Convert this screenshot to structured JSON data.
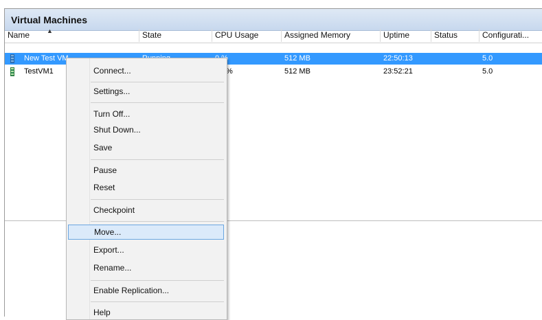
{
  "panel": {
    "title": "Virtual Machines"
  },
  "columns": {
    "name": "Name",
    "state": "State",
    "cpu": "CPU Usage",
    "memory": "Assigned Memory",
    "uptime": "Uptime",
    "status": "Status",
    "config": "Configurati..."
  },
  "vms": [
    {
      "name": "New Test VM",
      "state": "Running",
      "cpu": "0 %",
      "memory": "512 MB",
      "uptime": "22:50:13",
      "status": "",
      "config": "5.0",
      "selected": true
    },
    {
      "name": "TestVM1",
      "state": "",
      "cpu": "%",
      "memory": "512 MB",
      "uptime": "23:52:21",
      "status": "",
      "config": "5.0",
      "selected": false
    }
  ],
  "context_menu": {
    "connect": "Connect...",
    "settings": "Settings...",
    "turn_off": "Turn Off...",
    "shut_down": "Shut Down...",
    "save": "Save",
    "pause": "Pause",
    "reset": "Reset",
    "checkpoint": "Checkpoint",
    "move": "Move...",
    "export": "Export...",
    "rename": "Rename...",
    "enable_replication": "Enable Replication...",
    "help": "Help",
    "highlighted_item": "move"
  },
  "colors": {
    "selection": "#3399ff",
    "menu_highlight": "#dbeafa",
    "menu_highlight_border": "#6aa6e0"
  },
  "icons": {
    "vm_row_icon": "virtual-machine-icon",
    "sort_indicator": "sort-ascending-icon"
  }
}
